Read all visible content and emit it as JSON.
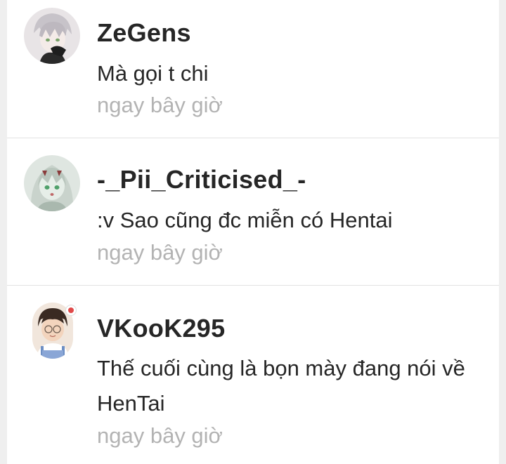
{
  "comments": [
    {
      "username": "ZeGens",
      "message": "Mà gọi t chi",
      "time": "ngay bây giờ",
      "avatar_icon": "anime-character-avatar-icon"
    },
    {
      "username": "-_Pii_Criticised_-",
      "message": ":v Sao cũng đc miễn có Hentai",
      "time": "ngay bây giờ",
      "avatar_icon": "anime-girl-avatar-icon"
    },
    {
      "username": "VKooK295",
      "message": "Thế cuối cùng là bọn mày đang nói về HenTai",
      "time": "ngay bây giờ",
      "avatar_icon": "child-photo-avatar-icon"
    }
  ],
  "colors": {
    "background": "#efefef",
    "panel": "#ffffff",
    "text": "#262626",
    "timestamp": "#b3b3b3",
    "divider": "#e2e2e2"
  }
}
